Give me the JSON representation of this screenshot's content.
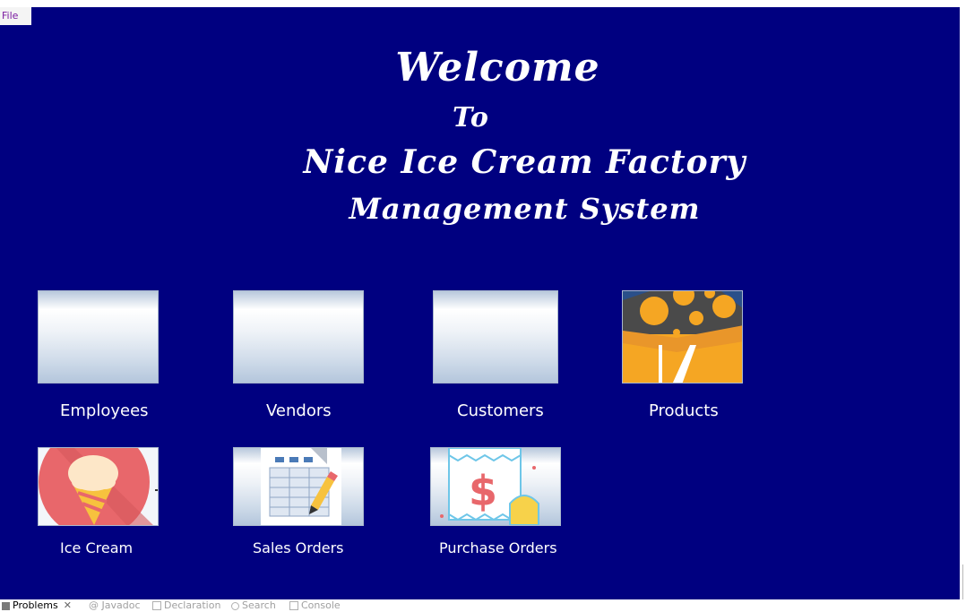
{
  "menu": {
    "file_label": "File"
  },
  "welcome": {
    "line1": "Welcome",
    "line2": "To",
    "line3": "Nice Ice Cream Factory",
    "line4": "Management System"
  },
  "tiles": [
    {
      "label": "Employees",
      "icon": "employees-icon"
    },
    {
      "label": "Vendors",
      "icon": "vendors-icon"
    },
    {
      "label": "Customers",
      "icon": "customers-icon"
    },
    {
      "label": "Products",
      "icon": "products-box-icon"
    },
    {
      "label": "Ice Cream",
      "icon": "ice-cream-cone-icon"
    },
    {
      "label": "Sales Orders",
      "icon": "sales-orders-sheet-icon"
    },
    {
      "label": "Purchase Orders",
      "icon": "purchase-orders-receipt-icon"
    }
  ],
  "statusbar": {
    "tabs": [
      {
        "label": "Problems",
        "active": true
      },
      {
        "label": "Javadoc",
        "active": false
      },
      {
        "label": "Declaration",
        "active": false
      },
      {
        "label": "Search",
        "active": false
      },
      {
        "label": "Console",
        "active": false
      }
    ]
  },
  "colors": {
    "background": "#000080",
    "text": "#ffffff",
    "tile_border": "#a9b7cc"
  }
}
